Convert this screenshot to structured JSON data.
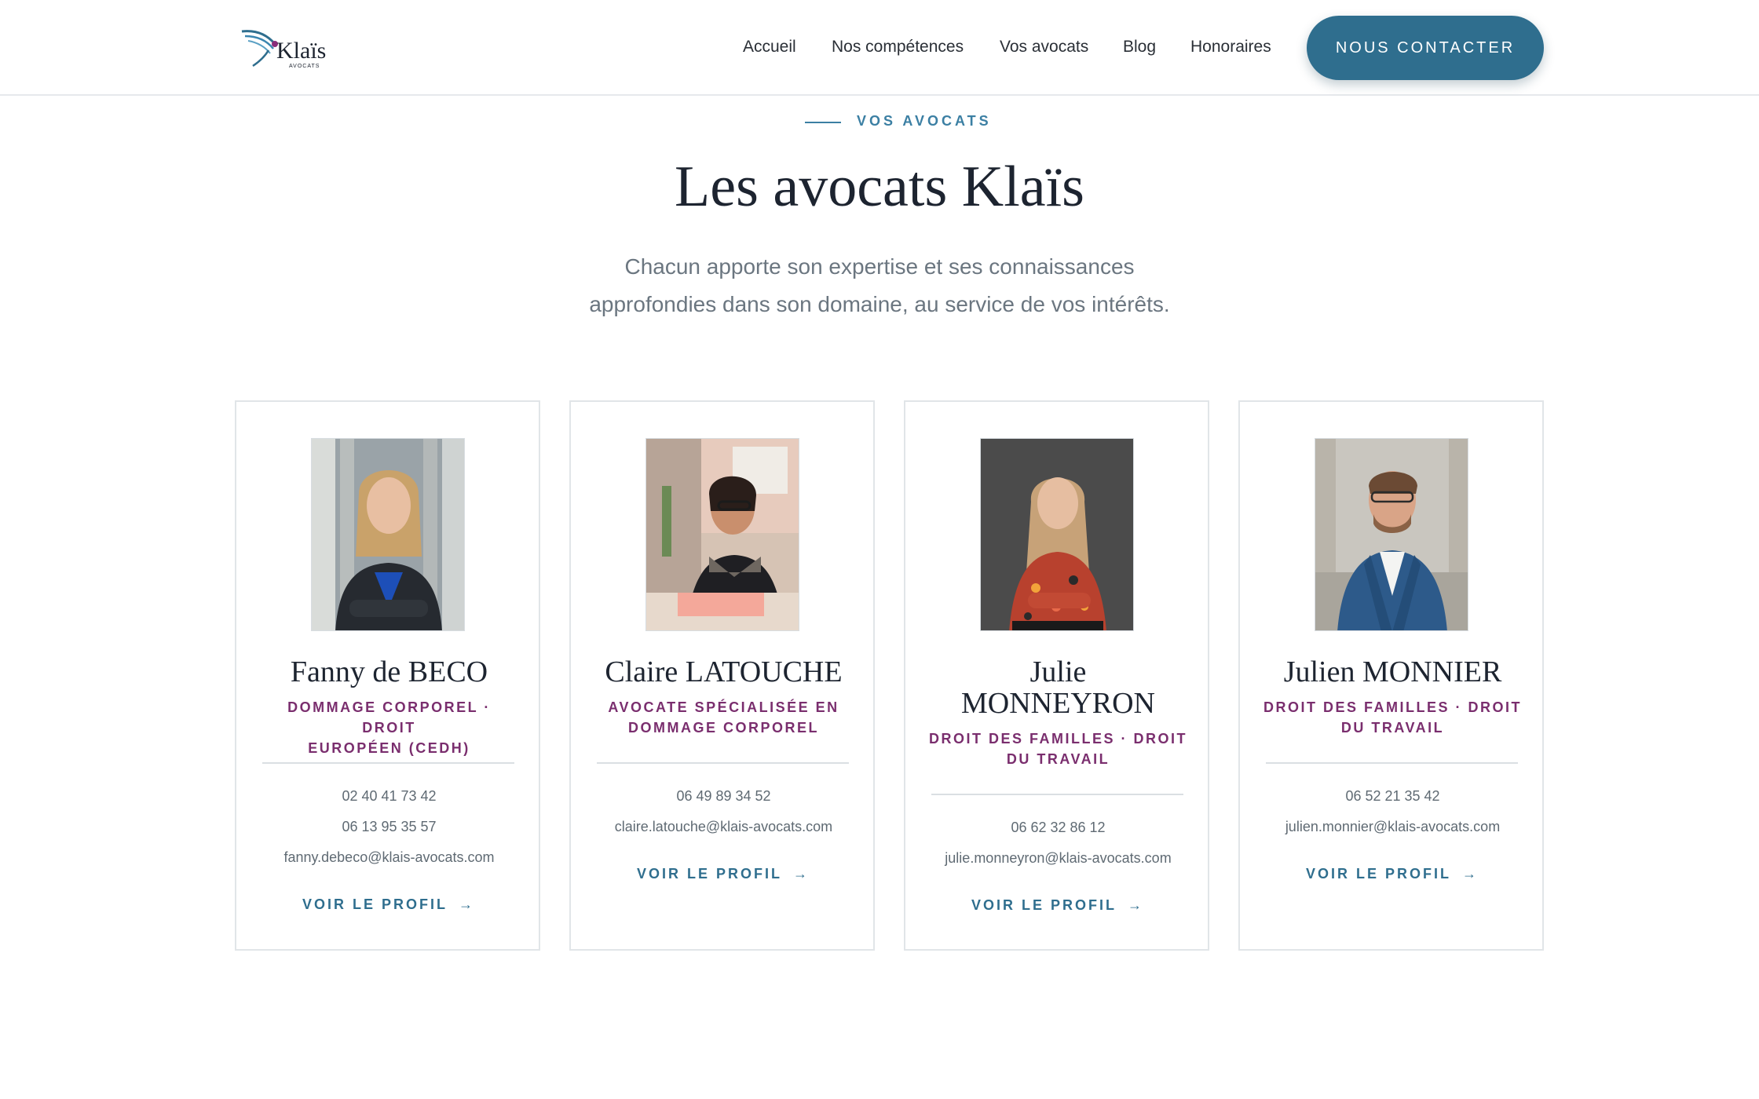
{
  "header": {
    "logo_text": "Klaïs",
    "logo_sub": "AVOCATS",
    "nav": [
      "Accueil",
      "Nos compétences",
      "Vos avocats",
      "Blog",
      "Honoraires"
    ],
    "cta": "NOUS CONTACTER"
  },
  "hero": {
    "eyebrow": "VOS AVOCATS",
    "title": "Les avocats Klaïs",
    "subtitle_line1": "Chacun apporte son expertise et ses connaissances",
    "subtitle_line2": "approfondies dans son domaine, au service de vos intérêts."
  },
  "colors": {
    "accent": "#2f6e8e",
    "specialty": "#7a2e6e",
    "text": "#1d2430"
  },
  "lawyers": [
    {
      "name": "Fanny de BECO",
      "specialty_line1": "DOMMAGE CORPOREL · DROIT",
      "specialty_line2": "EUROPÉEN (CEDH)",
      "phone1": "02 40 41 73 42",
      "phone2": "06 13 95 35 57",
      "email": "fanny.debeco@klais-avocats.com",
      "profile_label": "VOIR LE PROFIL"
    },
    {
      "name": "Claire LATOUCHE",
      "specialty_line1": "AVOCATE SPÉCIALISÉE EN",
      "specialty_line2": "DOMMAGE CORPOREL",
      "phone1": "06 49 89 34 52",
      "email": "claire.latouche@klais-avocats.com",
      "profile_label": "VOIR LE PROFIL"
    },
    {
      "name_line1": "Julie",
      "name_line2": "MONNEYRON",
      "specialty_line1": "DROIT DES FAMILLES · DROIT",
      "specialty_line2": "DU TRAVAIL",
      "phone1": "06 62 32 86 12",
      "email": "julie.monneyron@klais-avocats.com",
      "profile_label": "VOIR LE PROFIL"
    },
    {
      "name": "Julien MONNIER",
      "specialty_line1": "DROIT DES FAMILLES · DROIT",
      "specialty_line2": "DU TRAVAIL",
      "phone1": "06 52 21 35 42",
      "email": "julien.monnier@klais-avocats.com",
      "profile_label": "VOIR LE PROFIL"
    }
  ]
}
